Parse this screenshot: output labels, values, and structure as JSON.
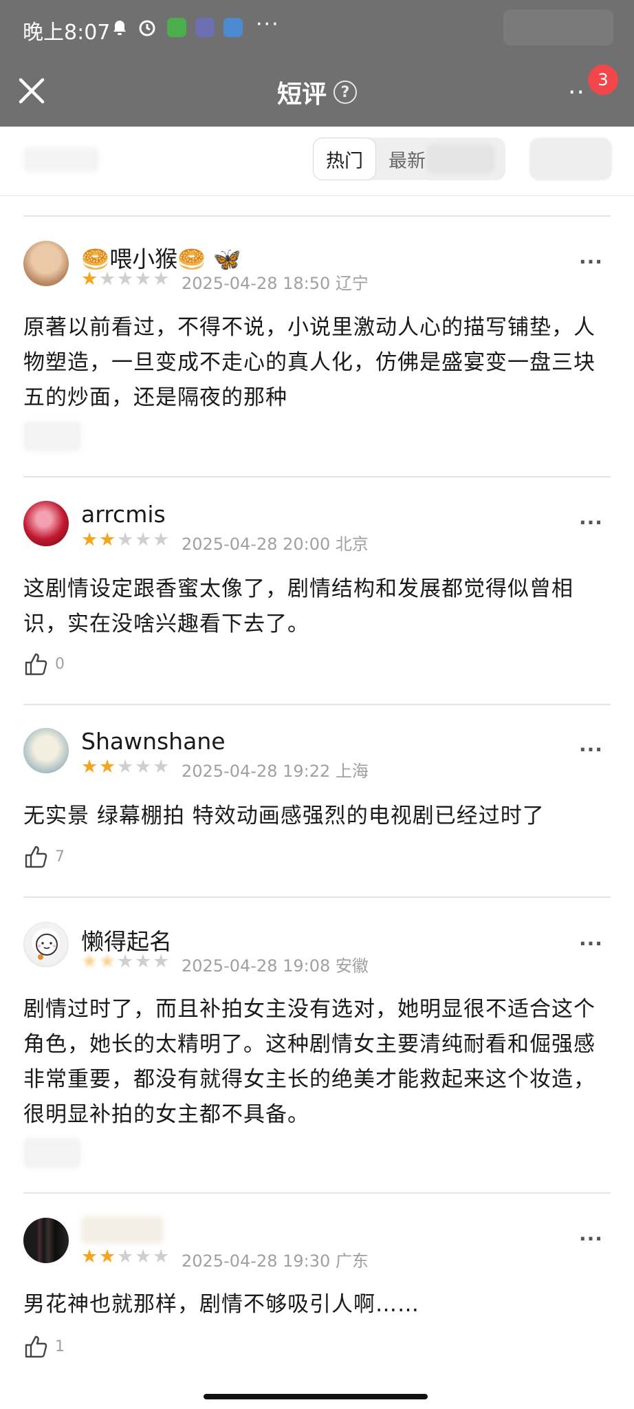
{
  "status_bar": {
    "time": "晚上8:07",
    "more": "···"
  },
  "nav": {
    "title": "短评",
    "help": "?",
    "more": "··",
    "badge_count": "3"
  },
  "tabs": {
    "hot": "热门",
    "new": "最新"
  },
  "reviews": [
    {
      "username": "🥯喂小猴🥯 🦋",
      "stars": 1,
      "meta": "2025-04-28 18:50 辽宁",
      "text": "原著以前看过，不得不说，小说里激动人心的描写铺垫，人物塑造，一旦变成不走心的真人化，仿佛是盛宴变一盘三块五的炒面，还是隔夜的那种",
      "likes": ""
    },
    {
      "username": "arrcmis",
      "stars": 2,
      "meta": "2025-04-28 20:00 北京",
      "text": "这剧情设定跟香蜜太像了，剧情结构和发展都觉得似曾相识，实在没啥兴趣看下去了。",
      "likes": "0"
    },
    {
      "username": "Shawnshane",
      "stars": 2,
      "meta": "2025-04-28 19:22 上海",
      "text": "无实景 绿幕棚拍 特效动画感强烈的电视剧已经过时了",
      "likes": "7"
    },
    {
      "username": "懒得起名",
      "stars": 2,
      "meta": "2025-04-28 19:08 安徽",
      "text": "剧情过时了，而且补拍女主没有选对，她明显很不适合这个角色，她长的太精明了。这种剧情女主要清纯耐看和倔强感非常重要，都没有就得女主长的绝美才能救起来这个妆造，很明显补拍的女主都不具备。",
      "likes": ""
    },
    {
      "username": "",
      "stars": 2,
      "meta": "2025-04-28 19:30 广东",
      "text": "男花神也就那样，剧情不够吸引人啊……",
      "likes": "1"
    }
  ],
  "more_dots": "···",
  "colors": {
    "star_active": "#f4a51c",
    "badge": "#f2474a",
    "header_dim": "#707070"
  }
}
